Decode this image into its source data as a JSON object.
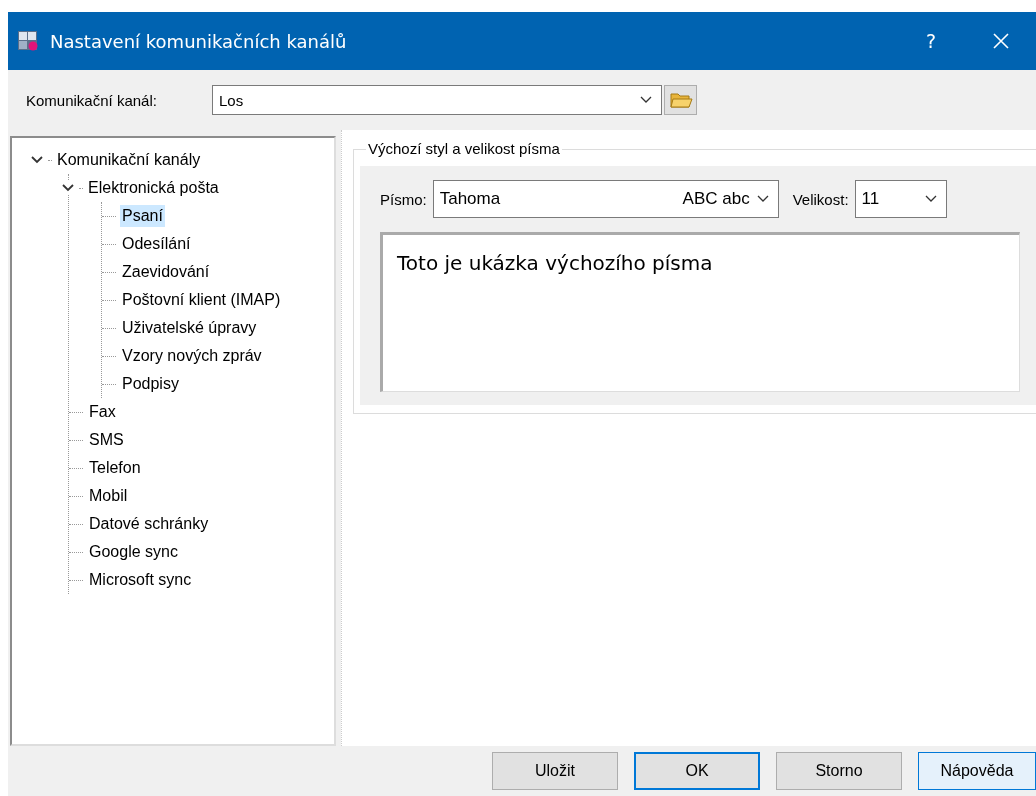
{
  "window": {
    "title": "Nastavení komunikačních kanálů",
    "help_button": "?"
  },
  "channel": {
    "label": "Komunikační kanál:",
    "value": "Los"
  },
  "tree": [
    {
      "label": "Komunikační kanály",
      "expanded": true,
      "selected": false,
      "children": [
        {
          "label": "Elektronická pošta",
          "expanded": true,
          "selected": false,
          "children": [
            {
              "label": "Psaní",
              "selected": true
            },
            {
              "label": "Odesílání",
              "selected": false
            },
            {
              "label": "Zaevidování",
              "selected": false
            },
            {
              "label": "Poštovní klient (IMAP)",
              "selected": false
            },
            {
              "label": "Uživatelské úpravy",
              "selected": false
            },
            {
              "label": "Vzory nových zpráv",
              "selected": false
            },
            {
              "label": "Podpisy",
              "selected": false
            }
          ]
        },
        {
          "label": "Fax",
          "selected": false
        },
        {
          "label": "SMS",
          "selected": false
        },
        {
          "label": "Telefon",
          "selected": false
        },
        {
          "label": "Mobil",
          "selected": false
        },
        {
          "label": "Datové schránky",
          "selected": false
        },
        {
          "label": "Google sync",
          "selected": false
        },
        {
          "label": "Microsoft sync",
          "selected": false
        }
      ]
    }
  ],
  "font_group": {
    "title": "Výchozí styl a velikost písma",
    "font_label": "Písmo:",
    "font_value": "Tahoma",
    "font_sample": "ABC abc",
    "size_label": "Velikost:",
    "size_value": "11",
    "preview": "Toto je ukázka výchozího písma"
  },
  "buttons": [
    {
      "label": "Uložit",
      "kind": "normal"
    },
    {
      "label": "OK",
      "kind": "default"
    },
    {
      "label": "Storno",
      "kind": "normal"
    },
    {
      "label": "Nápověda",
      "kind": "hover"
    }
  ]
}
